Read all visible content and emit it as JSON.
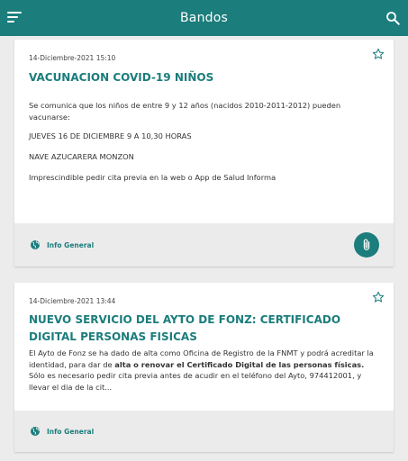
{
  "app": {
    "title": "Bandos",
    "accent": "#1b7d7c"
  },
  "toolbar": {
    "menu_icon": "menu-icon",
    "search_icon": "search-icon"
  },
  "bandos": [
    {
      "date": "14-Diciembre-2021 15:10",
      "title": "VACUNACION COVID-19 NIÑOS",
      "paragraphs": [
        "Se comunica que los niños de entre 9 y 12 años (nacidos 2010-2011-2012) pueden vacunarse:",
        "JUEVES 16 DE DICIEMBRE 9 A 10,30 HORAS",
        "NAVE AZUCARERA MONZON",
        "Imprescindible pedir cita previa en la web o App de Salud Informa"
      ],
      "category": "Info General",
      "has_attachment": true
    },
    {
      "date": "14-Diciembre-2021 13:44",
      "title": "NUEVO SERVICIO DEL AYTO DE FONZ: CERTIFICADO DIGITAL PERSONAS FISICAS",
      "body_parts": {
        "p1": "El Ayto de Fonz se ha dado de alta como Oficina de Registro de la FNMT y podrá acreditar la identidad, para dar de ",
        "b1": "alta o renovar el Certificado Digital de las personas físicas.",
        "p2": " Sólo es necesario pedir cita previa antes de acudir en el teléfono del Ayto, 974412001, y llevar el dia de la cit..."
      },
      "category": "Info General",
      "has_attachment": false
    }
  ]
}
